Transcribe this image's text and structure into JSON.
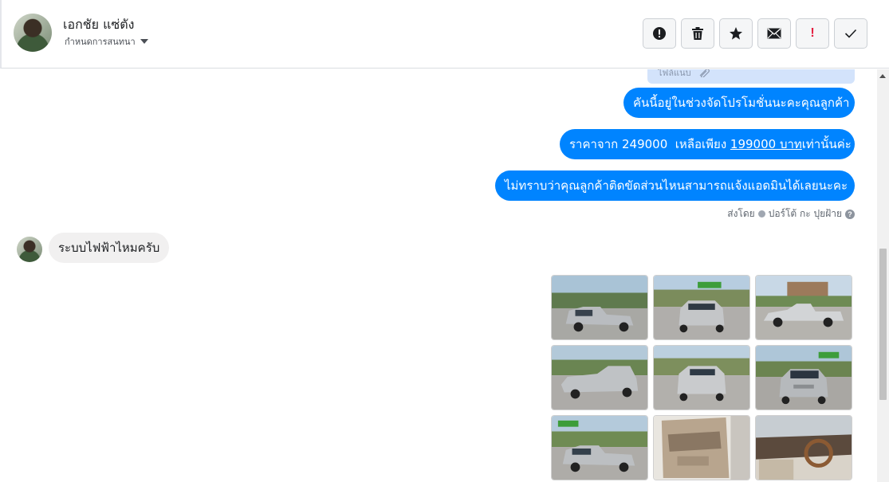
{
  "header": {
    "user_name": "เอกชัย แซ่ตัง",
    "conversation_settings": "กำหนดการสนทนา",
    "toolbar": [
      {
        "name": "report-icon",
        "label": ""
      },
      {
        "name": "trash-icon",
        "label": ""
      },
      {
        "name": "star-icon",
        "label": ""
      },
      {
        "name": "envelope-icon",
        "label": ""
      },
      {
        "name": "priority-icon",
        "label": "!"
      },
      {
        "name": "check-icon",
        "label": ""
      }
    ]
  },
  "chat": {
    "attachment_label": "ไฟล์แนบ",
    "outgoing": [
      {
        "text": "คันนี้อยู่ในช่วงจัดโปรโมชั่นนะคะคุณลูกค้า"
      },
      {
        "text_before": "ราคาจาก 249000  เหลือเพียง ",
        "text_link": "199000 บาท",
        "text_after": "เท่านั้นค่ะ"
      },
      {
        "text": "ไม่ทราบว่าคุณลูกค้าติดขัดส่วนไหนสามารถแจ้งแอดมินได้เลยนะคะ"
      }
    ],
    "sent_by_prefix": "ส่งโดย",
    "sent_by_name": "ปอร์โต้ กะ ปุยฝ้าย",
    "incoming_text": "ระบบไฟฟ้าไหมครับ",
    "gallery_count": 9
  },
  "colors": {
    "outgoing_bubble": "#0084ff",
    "incoming_bubble": "#f1f0f0",
    "attachment_card": "#d3e3fb",
    "priority_red": "#e41e3f"
  }
}
